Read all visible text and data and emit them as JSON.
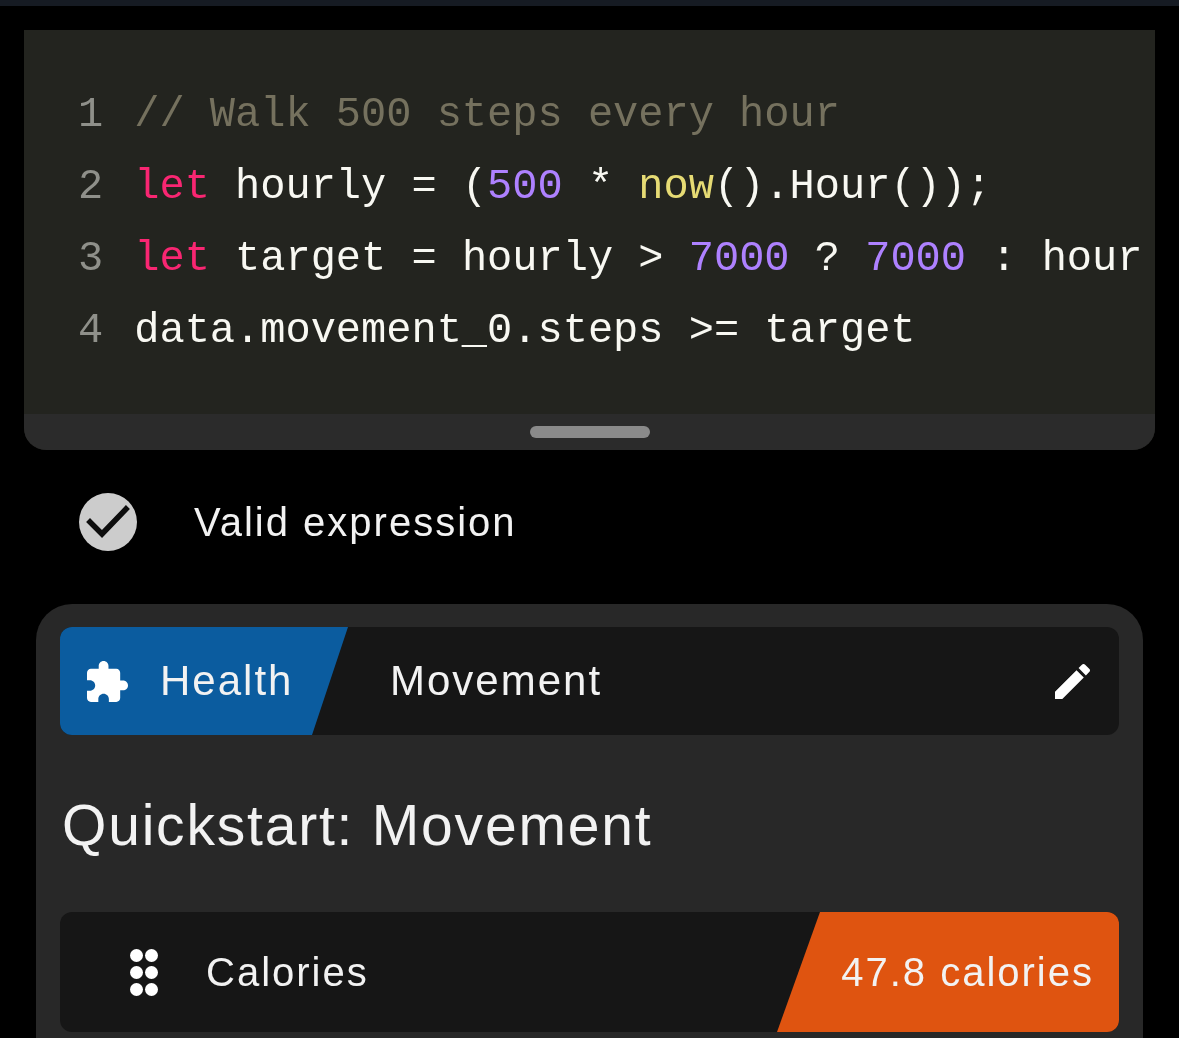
{
  "editor": {
    "lines": [
      {
        "number": "1",
        "tokens": [
          {
            "kind": "comment",
            "text": "// Walk 500 steps every hour"
          }
        ]
      },
      {
        "number": "2",
        "tokens": [
          {
            "kind": "keyword",
            "text": "let"
          },
          {
            "kind": "plain",
            "text": " hourly = ("
          },
          {
            "kind": "number",
            "text": "500"
          },
          {
            "kind": "plain",
            "text": " * "
          },
          {
            "kind": "function",
            "text": "now"
          },
          {
            "kind": "plain",
            "text": "().Hour());"
          }
        ]
      },
      {
        "number": "3",
        "tokens": [
          {
            "kind": "keyword",
            "text": "let"
          },
          {
            "kind": "plain",
            "text": " target = hourly > "
          },
          {
            "kind": "number",
            "text": "7000"
          },
          {
            "kind": "plain",
            "text": " ? "
          },
          {
            "kind": "number",
            "text": "7000"
          },
          {
            "kind": "plain",
            "text": " : hour"
          }
        ]
      },
      {
        "number": "4",
        "tokens": [
          {
            "kind": "plain",
            "text": "data.movement_0.steps >= target"
          }
        ]
      }
    ]
  },
  "validation": {
    "valid": true,
    "message": "Valid expression"
  },
  "card": {
    "header": {
      "category": "Health",
      "component": "Movement"
    },
    "title": "Quickstart: Movement",
    "rows": [
      {
        "label": "Calories",
        "value": "47.8 calories"
      }
    ]
  }
}
